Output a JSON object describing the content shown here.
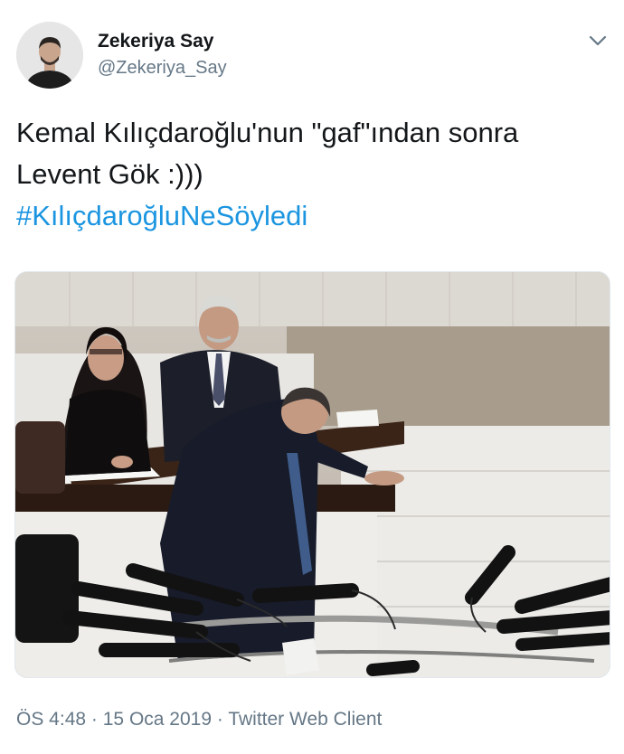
{
  "user": {
    "display_name": "Zekeriya Say",
    "handle": "@Zekeriya_Say"
  },
  "tweet": {
    "lines": [
      "Kemal Kılıçdaroğlu'nun \"gaf\"ından sonra",
      "Levent Gök :)))"
    ],
    "hashtag": "#KılıçdaroğluNeSöyledi"
  },
  "meta": {
    "time": "ÖS 4:48",
    "separator": "·",
    "date": "15 Oca 2019",
    "client": "Twitter Web Client"
  },
  "icons": {
    "menu": "chevron-down-icon"
  },
  "colors": {
    "text": "#14171a",
    "secondary": "#657786",
    "link": "#1b95e0"
  }
}
